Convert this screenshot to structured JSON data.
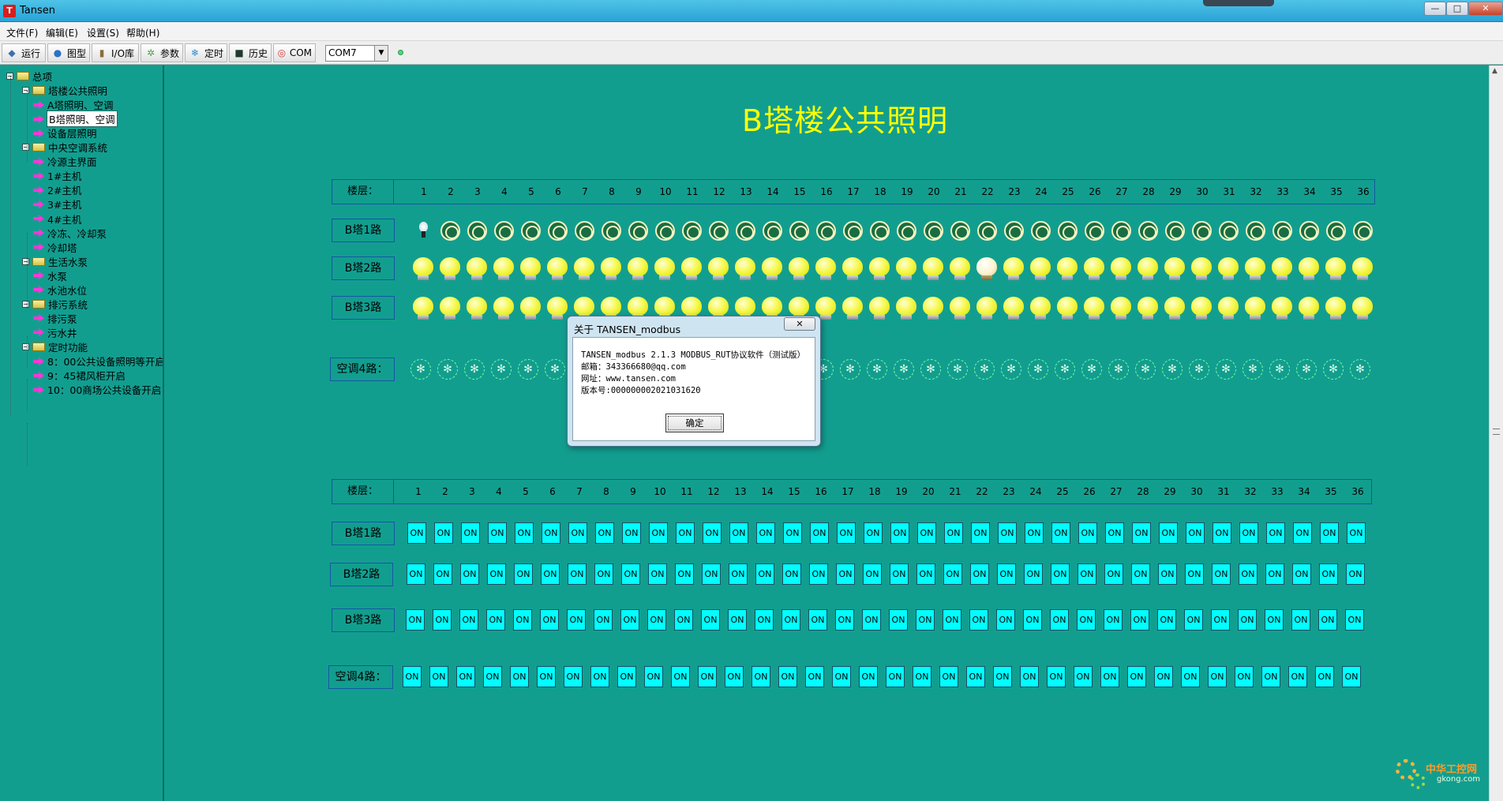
{
  "window": {
    "title": "Tansen",
    "icon_letter": "T",
    "minimize": "—",
    "maximize": "□",
    "close": "✕"
  },
  "menu": [
    "文件(F)",
    "编辑(E)",
    "设置(S)",
    "帮助(H)"
  ],
  "toolbar": {
    "buttons": [
      {
        "label": "运行",
        "icon": "run-icon",
        "glyph": "◆"
      },
      {
        "label": "图型",
        "icon": "globe-icon",
        "glyph": "●"
      },
      {
        "label": "I/O库",
        "icon": "database-icon",
        "glyph": "▮"
      },
      {
        "label": "参数",
        "icon": "gear-icon",
        "glyph": "✲"
      },
      {
        "label": "定时",
        "icon": "snowflake-icon",
        "glyph": "❄"
      },
      {
        "label": "历史",
        "icon": "monitor-icon",
        "glyph": "■"
      },
      {
        "label": "COM",
        "icon": "power-icon",
        "glyph": "◎"
      }
    ],
    "com_port": "COM7",
    "dropdown_arrow": "▼"
  },
  "tree": [
    {
      "label": "总项",
      "level": 0,
      "type": "folder",
      "expander": "−"
    },
    {
      "label": "塔楼公共照明",
      "level": 1,
      "type": "folder",
      "expander": "−"
    },
    {
      "label": "A塔照明、空调",
      "level": 2,
      "type": "leaf"
    },
    {
      "label": "B塔照明、空调",
      "level": 2,
      "type": "leaf",
      "selected": true
    },
    {
      "label": "设备层照明",
      "level": 2,
      "type": "leaf"
    },
    {
      "label": "中央空调系统",
      "level": 1,
      "type": "folder",
      "expander": "−"
    },
    {
      "label": "冷源主界面",
      "level": 2,
      "type": "leaf"
    },
    {
      "label": "1#主机",
      "level": 2,
      "type": "leaf"
    },
    {
      "label": "2#主机",
      "level": 2,
      "type": "leaf"
    },
    {
      "label": "3#主机",
      "level": 2,
      "type": "leaf"
    },
    {
      "label": "4#主机",
      "level": 2,
      "type": "leaf"
    },
    {
      "label": "冷冻、冷却泵",
      "level": 2,
      "type": "leaf"
    },
    {
      "label": "冷却塔",
      "level": 2,
      "type": "leaf"
    },
    {
      "label": "生活水泵",
      "level": 1,
      "type": "folder",
      "expander": "−"
    },
    {
      "label": "水泵",
      "level": 2,
      "type": "leaf"
    },
    {
      "label": "水池水位",
      "level": 2,
      "type": "leaf"
    },
    {
      "label": "排污系统",
      "level": 1,
      "type": "folder",
      "expander": "−"
    },
    {
      "label": "排污泵",
      "level": 2,
      "type": "leaf"
    },
    {
      "label": "污水井",
      "level": 2,
      "type": "leaf"
    },
    {
      "label": "定时功能",
      "level": 1,
      "type": "folder",
      "expander": "−"
    },
    {
      "label": "8：00公共设备照明等开启",
      "level": 2,
      "type": "leaf"
    },
    {
      "label": "9：45裙风柜开启",
      "level": 2,
      "type": "leaf"
    },
    {
      "label": "10：00商场公共设备开启",
      "level": 2,
      "type": "leaf"
    }
  ],
  "page_title": "B塔楼公共照明",
  "floor_label": "楼层：",
  "floors": [
    1,
    2,
    3,
    4,
    5,
    6,
    7,
    8,
    9,
    10,
    11,
    12,
    13,
    14,
    15,
    16,
    17,
    18,
    19,
    20,
    21,
    22,
    23,
    24,
    25,
    26,
    27,
    28,
    29,
    30,
    31,
    32,
    33,
    34,
    35,
    36
  ],
  "status_rows": [
    {
      "label": "B塔1路",
      "kind": "ring",
      "special": {
        "floor": 1,
        "kind": "small-bulb"
      }
    },
    {
      "label": "B塔2路",
      "kind": "bulb",
      "off_floors": [
        22
      ]
    },
    {
      "label": "B塔3路",
      "kind": "bulb",
      "off_floors": []
    },
    {
      "label": "空调4路：",
      "kind": "fan",
      "glyph": "✻"
    }
  ],
  "control_rows": [
    {
      "label": "B塔1路"
    },
    {
      "label": "B塔2路"
    },
    {
      "label": "B塔3路"
    },
    {
      "label": "空调4路："
    }
  ],
  "on_label": "ON",
  "dialog": {
    "title": "关于 TANSEN_modbus",
    "close": "✕",
    "lines": [
      "TANSEN_modbus 2.1.3 MODBUS_RUT协议软件（测试版）",
      "邮箱：343366680@qq.com",
      "网址：www.tansen.com",
      "版本号:000000002021031620"
    ],
    "ok": "确定"
  },
  "scroll": {
    "up": "▲"
  },
  "watermark": {
    "name": "中华工控网",
    "url": "gkong.com"
  }
}
